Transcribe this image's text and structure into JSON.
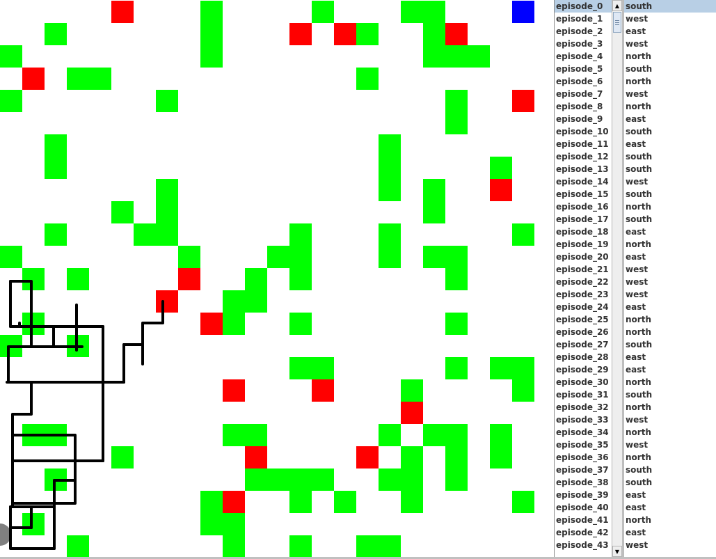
{
  "colors": {
    "free": "#ffffff",
    "reward": "#00ff00",
    "penalty": "#ff0000",
    "goal": "#0000ff",
    "agent": "#808080",
    "path": "#000000",
    "selected_row": "#b8cfe5"
  },
  "grid": {
    "cols": 24,
    "rows": 25,
    "cells": [
      "-----R---G----G---GG---B",
      "--G------G---R-RG--GR---",
      "G--------G---------GGG--",
      "-R-GG-----------G-------",
      "G------G------------G--R",
      "--------------------G---",
      "--G--------------G------",
      "--G--------------G----G-",
      "-------G---------G-G--R-",
      "-----G-G-----------G----",
      "--G---GG-----G---G-----G",
      "G-------G---GG---G-GG---",
      "-G-G----R--G-G------G---",
      "-------R--GG------------",
      "-G-------RG--G------G---",
      "G--G--------------------",
      "-------------GG-----G-GG",
      "----------R---R---G----G",
      "------------------R-----",
      "-GG-------GG-----G-GG-G-",
      "-----G-----R----R-G-G-G-",
      "--G--------GGGG--GG-G---",
      "---------GR--G-G--G----G",
      "-G-------GG-------------",
      "---G------G--G--GG------"
    ],
    "agent": {
      "row": 24,
      "col": 0
    },
    "path_segments": [
      [
        [
          15,
          404
        ],
        [
          45,
          404
        ],
        [
          45,
          469
        ]
      ],
      [
        [
          15,
          404
        ],
        [
          15,
          469
        ]
      ],
      [
        [
          15,
          469
        ],
        [
          148,
          469
        ]
      ],
      [
        [
          28,
          464
        ],
        [
          28,
          469
        ]
      ],
      [
        [
          110,
          438
        ],
        [
          110,
          503
        ]
      ],
      [
        [
          77,
          469
        ],
        [
          77,
          498
        ]
      ],
      [
        [
          12,
          498
        ],
        [
          118,
          498
        ]
      ],
      [
        [
          12,
          498
        ],
        [
          12,
          549
        ]
      ],
      [
        [
          45,
          469
        ],
        [
          45,
          495
        ]
      ],
      [
        [
          148,
          469
        ],
        [
          148,
          662
        ]
      ],
      [
        [
          10,
          549
        ],
        [
          178,
          549
        ]
      ],
      [
        [
          178,
          549
        ],
        [
          178,
          495
        ]
      ],
      [
        [
          178,
          495
        ],
        [
          205,
          495
        ]
      ],
      [
        [
          205,
          495
        ],
        [
          205,
          523
        ]
      ],
      [
        [
          205,
          495
        ],
        [
          205,
          464
        ],
        [
          234,
          464
        ],
        [
          234,
          433
        ]
      ],
      [
        [
          45,
          549
        ],
        [
          45,
          595
        ],
        [
          18,
          595
        ],
        [
          18,
          728
        ]
      ],
      [
        [
          18,
          625
        ],
        [
          108,
          625
        ],
        [
          108,
          662
        ]
      ],
      [
        [
          18,
          662
        ],
        [
          108,
          662
        ]
      ],
      [
        [
          108,
          662
        ],
        [
          148,
          662
        ]
      ],
      [
        [
          108,
          662
        ],
        [
          108,
          723
        ],
        [
          18,
          723
        ]
      ],
      [
        [
          15,
          728
        ],
        [
          15,
          788
        ],
        [
          78,
          788
        ]
      ],
      [
        [
          78,
          728
        ],
        [
          78,
          788
        ]
      ],
      [
        [
          78,
          690
        ],
        [
          78,
          728
        ]
      ],
      [
        [
          78,
          690
        ],
        [
          108,
          690
        ]
      ],
      [
        [
          45,
          728
        ],
        [
          45,
          758
        ]
      ],
      [
        [
          15,
          758
        ],
        [
          45,
          758
        ]
      ],
      [
        [
          15,
          728
        ],
        [
          78,
          728
        ]
      ]
    ]
  },
  "episodes": [
    "episode_0",
    "episode_1",
    "episode_2",
    "episode_3",
    "episode_4",
    "episode_5",
    "episode_6",
    "episode_7",
    "episode_8",
    "episode_9",
    "episode_10",
    "episode_11",
    "episode_12",
    "episode_13",
    "episode_14",
    "episode_15",
    "episode_16",
    "episode_17",
    "episode_18",
    "episode_19",
    "episode_20",
    "episode_21",
    "episode_22",
    "episode_23",
    "episode_24",
    "episode_25",
    "episode_26",
    "episode_27",
    "episode_28",
    "episode_29",
    "episode_30",
    "episode_31",
    "episode_32",
    "episode_33",
    "episode_34",
    "episode_35",
    "episode_36",
    "episode_37",
    "episode_38",
    "episode_39",
    "episode_40",
    "episode_41",
    "episode_42",
    "episode_43"
  ],
  "actions": [
    "south",
    "west",
    "east",
    "west",
    "north",
    "south",
    "north",
    "west",
    "north",
    "east",
    "south",
    "east",
    "south",
    "south",
    "west",
    "south",
    "north",
    "south",
    "east",
    "north",
    "east",
    "west",
    "west",
    "west",
    "east",
    "north",
    "north",
    "south",
    "east",
    "east",
    "north",
    "south",
    "north",
    "west",
    "north",
    "west",
    "north",
    "south",
    "south",
    "east",
    "east",
    "north",
    "east",
    "west"
  ],
  "selected_index": 0,
  "scrollbar": {
    "up_icon": "▲",
    "down_icon": "▼"
  }
}
